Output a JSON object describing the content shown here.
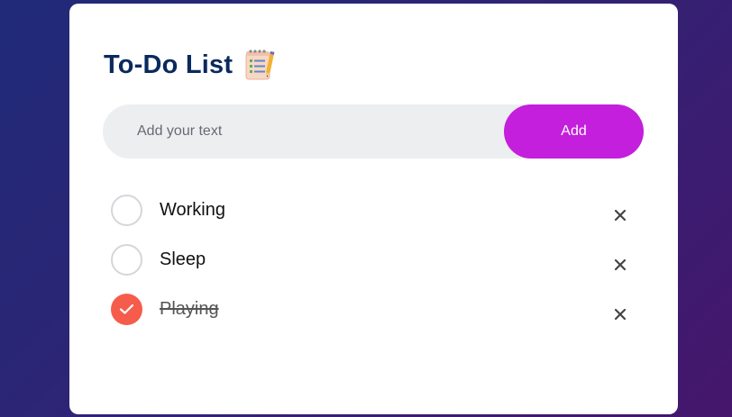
{
  "app": {
    "title": "To-Do List",
    "title_icon": "notepad-icon"
  },
  "input": {
    "value": "",
    "placeholder": "Add your text"
  },
  "add_button": {
    "label": "Add",
    "color": "#c31fdc"
  },
  "tasks": [
    {
      "label": "Working",
      "done": false,
      "remove_icon": "close-icon"
    },
    {
      "label": "Sleep",
      "done": false,
      "remove_icon": "close-icon"
    },
    {
      "label": "Playing",
      "done": true,
      "remove_icon": "close-icon"
    }
  ],
  "colors": {
    "background_start": "#1f2a78",
    "background_end": "#45166c",
    "title": "#0a2a5e",
    "checked": "#f65c4b"
  }
}
